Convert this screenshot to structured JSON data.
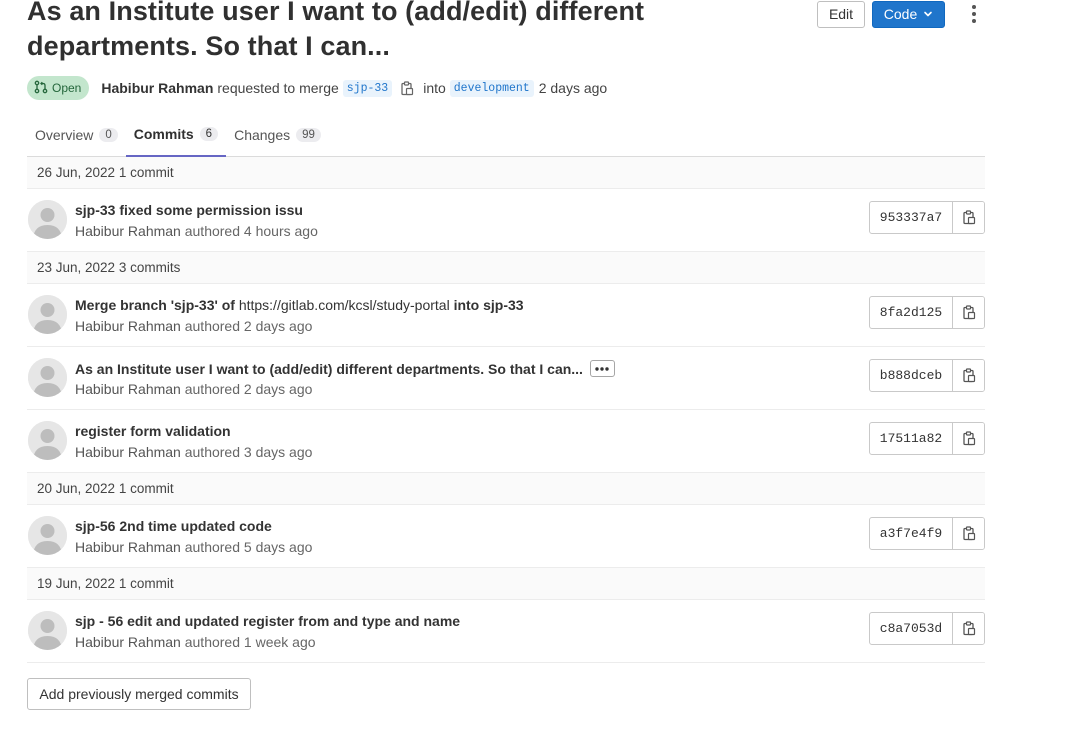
{
  "header": {
    "title": "As an Institute user I want to (add/edit) different departments. So that I can...",
    "edit_label": "Edit",
    "code_label": "Code"
  },
  "meta": {
    "status": "Open",
    "author": "Habibur Rahman",
    "action_text": "requested to merge",
    "source_branch": "sjp-33",
    "into_text": "into",
    "target_branch": "development",
    "time": "2 days ago"
  },
  "tabs": [
    {
      "label": "Overview",
      "count": "0"
    },
    {
      "label": "Commits",
      "count": "6"
    },
    {
      "label": "Changes",
      "count": "99"
    }
  ],
  "days": [
    {
      "header": "26 Jun, 2022 1 commit",
      "commits": [
        {
          "title": "sjp-33 fixed some permission issu",
          "author": "Habibur Rahman",
          "authored_text": "authored",
          "time": "4 hours ago",
          "sha": "953337a7"
        }
      ]
    },
    {
      "header": "23 Jun, 2022 3 commits",
      "commits": [
        {
          "title_prefix": "Merge branch 'sjp-33' of ",
          "title_link": "https://gitlab.com/kcsl/study-portal",
          "title_suffix": " into sjp-33",
          "author": "Habibur Rahman",
          "authored_text": "authored",
          "time": "2 days ago",
          "sha": "8fa2d125"
        },
        {
          "title": "As an Institute user I want to (add/edit) different departments. So that I can...",
          "author": "Habibur Rahman",
          "authored_text": "authored",
          "time": "2 days ago",
          "sha": "b888dceb"
        },
        {
          "title": "register form validation",
          "author": "Habibur Rahman",
          "authored_text": "authored",
          "time": "3 days ago",
          "sha": "17511a82"
        }
      ]
    },
    {
      "header": "20 Jun, 2022 1 commit",
      "commits": [
        {
          "title": "sjp-56 2nd time updated code",
          "author": "Habibur Rahman",
          "authored_text": "authored",
          "time": "5 days ago",
          "sha": "a3f7e4f9"
        }
      ]
    },
    {
      "header": "19 Jun, 2022 1 commit",
      "commits": [
        {
          "title": "sjp - 56 edit and updated register from and type and name",
          "author": "Habibur Rahman",
          "authored_text": "authored",
          "time": "1 week ago",
          "sha": "c8a7053d"
        }
      ]
    }
  ],
  "footer": {
    "add_previous_label": "Add previously merged commits"
  },
  "colors": {
    "primary": "#1f75cb",
    "open_badge_bg": "#c3e6cd",
    "open_badge_text": "#24663b",
    "active_tab": "#6666c4"
  },
  "icons": {
    "status": "merge-request-icon",
    "copy": "clipboard-icon",
    "more": "kebab-vertical-icon",
    "code_dropdown": "chevron-down-icon",
    "expand": "ellipsis-icon",
    "avatar": "default-avatar-icon"
  }
}
